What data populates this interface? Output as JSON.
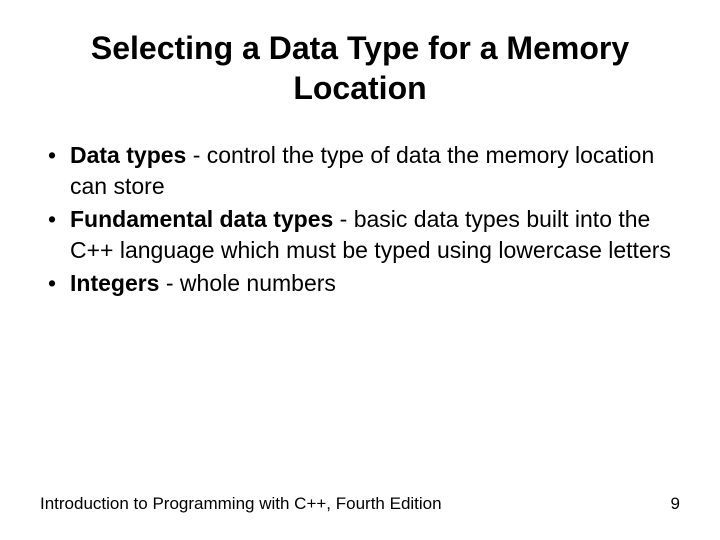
{
  "title": "Selecting a Data Type for a Memory Location",
  "bullets": [
    {
      "term": "Data types",
      "rest": " - control the type of data the memory location can store"
    },
    {
      "term": "Fundamental data types",
      "rest": " - basic data types built into the C++ language which must be typed using lowercase letters"
    },
    {
      "term": "Integers",
      "rest": " - whole numbers"
    }
  ],
  "footer": {
    "source": "Introduction to Programming with C++, Fourth Edition",
    "page": "9"
  }
}
